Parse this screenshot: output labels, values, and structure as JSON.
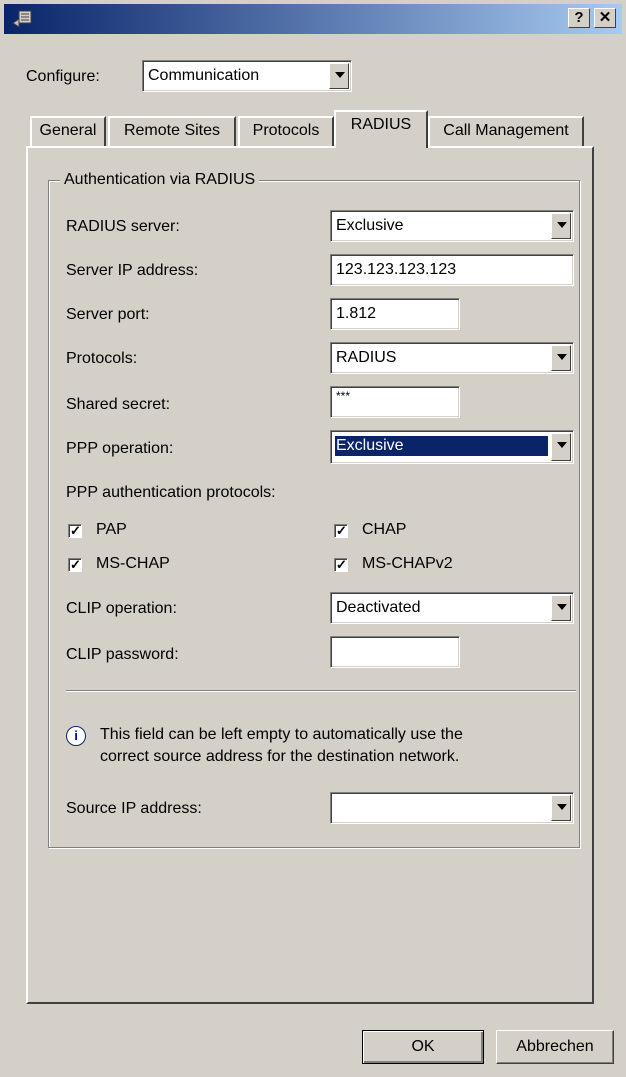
{
  "titlebar": {
    "help_label": "?",
    "close_label": "✕",
    "icon": "app-icon"
  },
  "configure": {
    "label": "Configure:",
    "value": "Communication"
  },
  "tabs": [
    {
      "label": "General"
    },
    {
      "label": "Remote Sites"
    },
    {
      "label": "Protocols"
    },
    {
      "label": "RADIUS"
    },
    {
      "label": "Call Management"
    }
  ],
  "group": {
    "title": "Authentication via RADIUS"
  },
  "fields": {
    "radius_server": {
      "label": "RADIUS server:",
      "value": "Exclusive"
    },
    "server_ip": {
      "label": "Server IP address:",
      "value": "123.123.123.123"
    },
    "server_port": {
      "label": "Server port:",
      "value": "1.812"
    },
    "protocols": {
      "label": "Protocols:",
      "value": "RADIUS"
    },
    "shared_secret": {
      "label": "Shared secret:",
      "value": "***"
    },
    "ppp_operation": {
      "label": "PPP operation:",
      "value": "Exclusive"
    },
    "ppp_auth_label": "PPP authentication protocols:",
    "pap": {
      "label": "PAP",
      "checked": "✓"
    },
    "chap": {
      "label": "CHAP",
      "checked": "✓"
    },
    "mschap": {
      "label": "MS-CHAP",
      "checked": "✓"
    },
    "mschapv2": {
      "label": "MS-CHAPv2",
      "checked": "✓"
    },
    "clip_operation": {
      "label": "CLIP operation:",
      "value": "Deactivated"
    },
    "clip_password": {
      "label": "CLIP password:",
      "value": ""
    },
    "info_line1": "This field can be left empty to automatically use the",
    "info_line2": "correct source address for the destination network.",
    "source_ip": {
      "label": "Source IP address:",
      "value": ""
    }
  },
  "buttons": {
    "ok": "OK",
    "cancel": "Abbrechen"
  }
}
